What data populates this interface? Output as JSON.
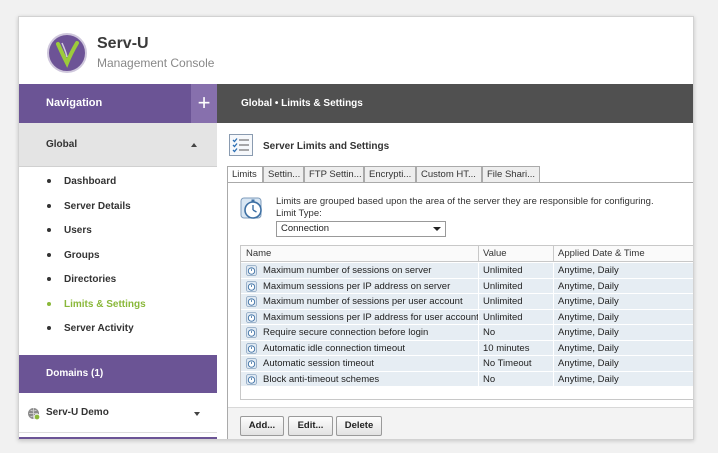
{
  "app": {
    "title": "Serv-U",
    "subtitle": "Management Console"
  },
  "sidebar": {
    "nav_label": "Navigation",
    "add_symbol": "+",
    "global_label": "Global",
    "items": [
      {
        "label": "Dashboard"
      },
      {
        "label": "Server Details"
      },
      {
        "label": "Users"
      },
      {
        "label": "Groups"
      },
      {
        "label": "Directories"
      },
      {
        "label": "Limits & Settings",
        "active": true
      },
      {
        "label": "Server Activity"
      }
    ],
    "domains_label": "Domains (1)",
    "domain_item": "Serv-U Demo"
  },
  "main": {
    "breadcrumb": "Global • Limits & Settings",
    "panel_title": "Server Limits and Settings",
    "tabs": [
      {
        "label": "Limits",
        "active": true
      },
      {
        "label": "Settin..."
      },
      {
        "label": "FTP Settin..."
      },
      {
        "label": "Encrypti..."
      },
      {
        "label": "Custom HT..."
      },
      {
        "label": "File Shari..."
      }
    ],
    "info_text": "Limits are grouped based upon the area of the server they are responsible for configuring.",
    "limit_type_label": "Limit Type:",
    "limit_type_value": "Connection",
    "table": {
      "headers": [
        "Name",
        "Value",
        "Applied Date & Time"
      ],
      "rows": [
        [
          "Maximum number of sessions on server",
          "Unlimited",
          "Anytime, Daily"
        ],
        [
          "Maximum sessions per IP address on server",
          "Unlimited",
          "Anytime, Daily"
        ],
        [
          "Maximum number of sessions per user account",
          "Unlimited",
          "Anytime, Daily"
        ],
        [
          "Maximum sessions per IP address for user account",
          "Unlimited",
          "Anytime, Daily"
        ],
        [
          "Require secure connection before login",
          "No",
          "Anytime, Daily"
        ],
        [
          "Automatic idle connection timeout",
          "10 minutes",
          "Anytime, Daily"
        ],
        [
          "Automatic session timeout",
          "No Timeout",
          "Anytime, Daily"
        ],
        [
          "Block anti-timeout schemes",
          "No",
          "Anytime, Daily"
        ]
      ]
    },
    "buttons": {
      "add": "Add...",
      "edit": "Edit...",
      "delete": "Delete"
    }
  },
  "colors": {
    "brand_purple": "#6b5495",
    "accent_green": "#8ab83a",
    "topbar_gray": "#505050",
    "row_blue": "#e6edf3"
  },
  "icons": {
    "logo": "serv-u-logo",
    "add": "plus-icon",
    "collapse": "caret-up-icon",
    "expand": "caret-down-icon",
    "domain": "globe-icon",
    "panel": "checklist-icon",
    "info": "stopwatch-icon",
    "row": "limit-icon"
  }
}
